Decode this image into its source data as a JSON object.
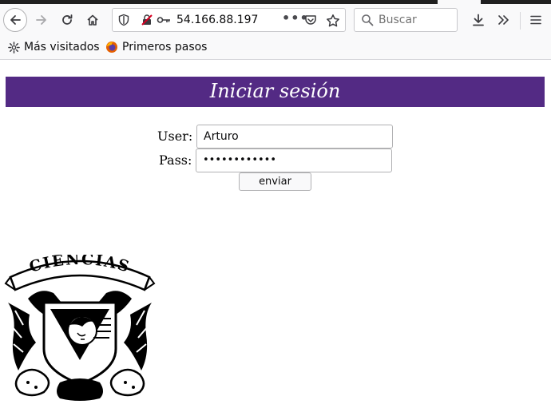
{
  "browser": {
    "url": "54.166.88.197",
    "page_actions_label": "•••",
    "search_placeholder": "Buscar"
  },
  "bookmarks": [
    {
      "label": "Más visitados",
      "icon": "gear-icon"
    },
    {
      "label": "Primeros pasos",
      "icon": "firefox-icon"
    }
  ],
  "page": {
    "title": "Iniciar sesión",
    "header_color": "#532a84",
    "user_label": "User:",
    "user_value": "Arturo",
    "pass_label": "Pass:",
    "pass_value": "••••••••••••",
    "submit_label": "enviar",
    "logo_text": "CIENCIAS"
  }
}
